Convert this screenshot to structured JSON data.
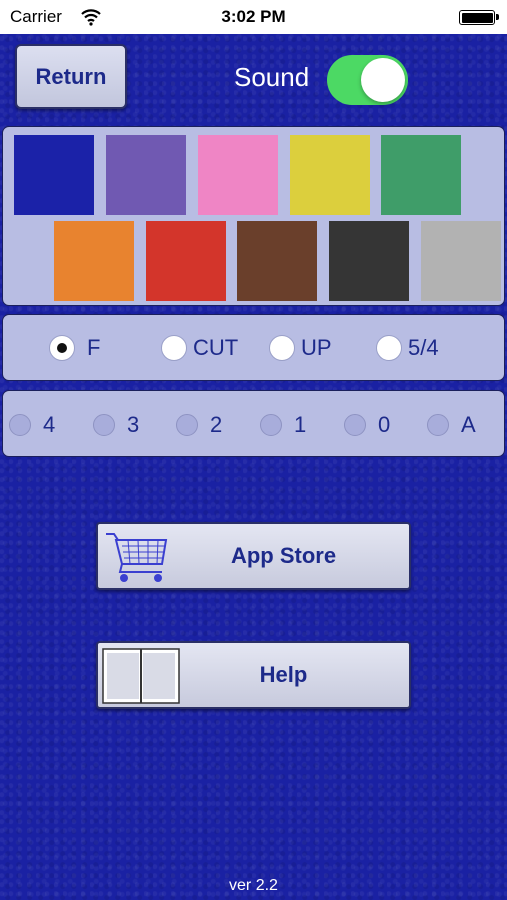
{
  "status_bar": {
    "carrier": "Carrier",
    "time": "3:02 PM"
  },
  "header": {
    "return_label": "Return",
    "sound_label": "Sound",
    "sound_on": true
  },
  "colors": {
    "row1": [
      "#1b22a8",
      "#7059b2",
      "#ef85c5",
      "#dccf3d",
      "#3f9d69"
    ],
    "row2": [
      "#e8832f",
      "#d3352b",
      "#6a3f2b",
      "#353535",
      "#b2b2b2"
    ]
  },
  "mode_options": [
    {
      "label": "F",
      "selected": true
    },
    {
      "label": "CUT",
      "selected": false
    },
    {
      "label": "UP",
      "selected": false
    },
    {
      "label": "5/4",
      "selected": false
    }
  ],
  "level_options": [
    {
      "label": "4"
    },
    {
      "label": "3"
    },
    {
      "label": "2"
    },
    {
      "label": "1"
    },
    {
      "label": "0"
    },
    {
      "label": "A"
    }
  ],
  "buttons": {
    "app_store": "App Store",
    "help": "Help"
  },
  "footer": {
    "version": "ver 2.2"
  }
}
